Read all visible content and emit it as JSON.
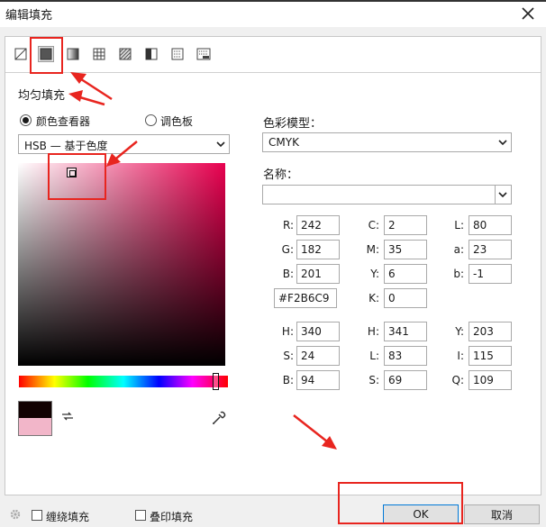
{
  "window": {
    "title": "编辑填充"
  },
  "toolbar": {
    "tools": [
      {
        "icon": "no-fill-icon"
      },
      {
        "icon": "uniform-fill-icon",
        "selected": true
      },
      {
        "icon": "fountain-fill-icon"
      },
      {
        "icon": "vector-pattern-fill-icon"
      },
      {
        "icon": "bitmap-pattern-fill-icon"
      },
      {
        "icon": "two-color-pattern-fill-icon"
      },
      {
        "icon": "texture-fill-icon"
      },
      {
        "icon": "postscript-fill-icon"
      }
    ]
  },
  "section": {
    "label": "均匀填充"
  },
  "mode": {
    "viewer_label": "颜色查看器",
    "palette_label": "调色板",
    "selected": "viewer"
  },
  "model_select": {
    "value": "HSB — 基于色度"
  },
  "color": {
    "current_hex": "#F2B6C9",
    "previous_hex": "#120202",
    "hue_fraction": 0.94
  },
  "right": {
    "model_label": "色彩模型：",
    "model_value": "CMYK",
    "name_label": "名称：",
    "name_value": ""
  },
  "fields": {
    "R": {
      "label": "R:",
      "value": "242"
    },
    "G": {
      "label": "G:",
      "value": "182"
    },
    "B": {
      "label": "B:",
      "value": "201"
    },
    "hex": {
      "value": "#F2B6C9"
    },
    "C": {
      "label": "C:",
      "value": "2"
    },
    "M": {
      "label": "M:",
      "value": "35"
    },
    "Y": {
      "label": "Y:",
      "value": "6"
    },
    "K": {
      "label": "K:",
      "value": "0"
    },
    "L": {
      "label": "L:",
      "value": "80"
    },
    "a": {
      "label": "a:",
      "value": "23"
    },
    "b": {
      "label": "b:",
      "value": "-1"
    },
    "H1": {
      "label": "H:",
      "value": "340"
    },
    "S1": {
      "label": "S:",
      "value": "24"
    },
    "B1": {
      "label": "B:",
      "value": "94"
    },
    "H2": {
      "label": "H:",
      "value": "341"
    },
    "L2": {
      "label": "L:",
      "value": "83"
    },
    "S2": {
      "label": "S:",
      "value": "69"
    },
    "Y2": {
      "label": "Y:",
      "value": "203"
    },
    "I": {
      "label": "I:",
      "value": "115"
    },
    "Q": {
      "label": "Q:",
      "value": "109"
    }
  },
  "bottom": {
    "wrap_fill_label": "缠绕填充",
    "overprint_fill_label": "叠印填充",
    "ok_label": "OK",
    "cancel_label": "取消"
  },
  "colors": {
    "annotation_red": "#e8251f",
    "accent_blue": "#0078d7"
  }
}
